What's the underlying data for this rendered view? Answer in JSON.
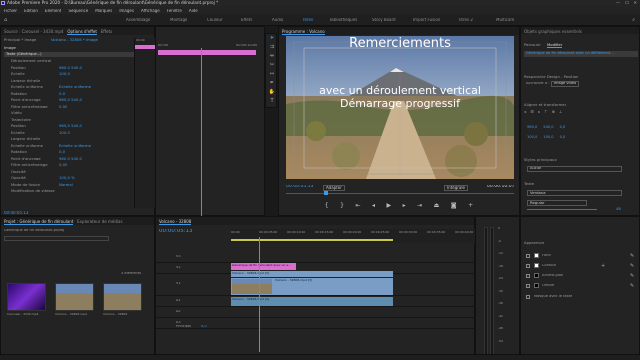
{
  "window": {
    "title": "Adobe Premiere Pro 2020 - D:\\Bureau\\Générique de fin déroulant\\Générique de fin déroulant.prproj *"
  },
  "menu": [
    "Fichier",
    "Edition",
    "Elément",
    "Séquence",
    "Marques",
    "Images",
    "Affichage",
    "Fenêtre",
    "Aide"
  ],
  "workspaces": [
    "Assemblage",
    "Montage",
    "Couleur",
    "Effets",
    "Audio",
    "Titres",
    "Bibliothèques",
    "Story Board",
    "Import Fusion",
    "Titres 2",
    "Multicam"
  ],
  "active_workspace": "Titres",
  "effects_panel": {
    "tabs": [
      "Source : Carousel - 3430.mp4",
      "Options d'effet",
      "Effets"
    ],
    "header": "Principal * Image",
    "clip": "Volcano - 32808 * Image",
    "time_start": "00:00",
    "time_end": "00:00:10:00",
    "group_title": "Image",
    "text_layer": "Texte (Générique...)",
    "rows": [
      {
        "label": "Déroulement vertical",
        "value": ""
      },
      {
        "label": "Position",
        "value": "960,0   540,0"
      },
      {
        "label": "Echelle",
        "value": "100,0"
      },
      {
        "label": "Largeur échelle",
        "value": ""
      },
      {
        "label": "Echelle uniforme",
        "value": "Echelle uniforme"
      },
      {
        "label": "Rotation",
        "value": "0,0"
      },
      {
        "label": "Point d'ancrage",
        "value": "960,0   540,0"
      },
      {
        "label": "Filtre anticrénelage",
        "value": "0,00"
      },
      {
        "label": "Vidéo",
        "value": ""
      },
      {
        "label": "Trajectoire",
        "value": ""
      },
      {
        "label": "Position",
        "value": "960,0   540,0"
      },
      {
        "label": "Echelle",
        "value": "100,0"
      },
      {
        "label": "Largeur échelle",
        "value": ""
      },
      {
        "label": "Echelle uniforme",
        "value": "Echelle uniforme"
      },
      {
        "label": "Rotation",
        "value": "0,0"
      },
      {
        "label": "Point d'ancrage",
        "value": "960,0   540,0"
      },
      {
        "label": "Filtre anticrénelage",
        "value": "0,00"
      },
      {
        "label": "Opacité",
        "value": ""
      },
      {
        "label": "Opacité",
        "value": "100,0 %"
      },
      {
        "label": "Mode de fusion",
        "value": "Normal"
      },
      {
        "label": "Modification de vitesse",
        "value": ""
      }
    ],
    "timecode": "00:00:05:13"
  },
  "program_monitor": {
    "tab": "Programme : Volcano",
    "title_lines": [
      "Remerciements",
      "avec un déroulement vertical",
      "Démarrage progressif"
    ],
    "timecode": "00:00:05:13",
    "fit": "Adapter",
    "quality": "Intégrale",
    "duration": "00:00:10:07"
  },
  "essential_graphics": {
    "tabs": [
      "Parcourir",
      "Modifier"
    ],
    "layer": "Générique de fin déroulant avec un défilement...",
    "responsive_label": "Responsive Design - Position",
    "pin_label": "Accrocher à :",
    "pin_value": "Image vidéo",
    "align_label": "Aligner et transformer",
    "pos_values": [
      "960,0",
      "540,0",
      "0,0",
      "100,0",
      "100,0",
      "0,0"
    ],
    "master_styles_label": "Styles principaux",
    "master_styles_value": "Aucun",
    "text_label": "Texte",
    "font": "Verdana",
    "font_style": "Regular",
    "font_size": "48",
    "appearance_label": "Apparence",
    "fill_label": "Fond",
    "stroke_label": "Contour",
    "bg_label": "Arrière-plan",
    "shadow_label": "Ombre",
    "mask_label": "Masque avec le texte",
    "colors": {
      "fill": "#ffffff",
      "stroke": "#ffffff",
      "bg": "#000000",
      "shadow": "#000000"
    }
  },
  "project_panel": {
    "tabs": [
      "Projet : Générique de fin déroulant",
      "Explorateur de médias"
    ],
    "path": "Générique de fin déroulant.prproj",
    "count": "3 éléments",
    "items": [
      {
        "name": "Carousel - 3430.mp4",
        "duration": "10:07"
      },
      {
        "name": "Volcano - 32808.mp4",
        "duration": "10:07"
      },
      {
        "name": "Volcano - 32808",
        "duration": "10:07"
      }
    ]
  },
  "timeline": {
    "tab": "Volcano - 32808",
    "timecode": "00:00:05:13",
    "ruler": [
      "00:00",
      "00:00:05:00",
      "00:00:10:00",
      "00:00:15:00",
      "00:00:20:00",
      "00:00:25:00",
      "00:00:30:00",
      "00:00:35:00",
      "00:00:40:00"
    ],
    "tracks": [
      "V3",
      "V2",
      "V1",
      "A1",
      "A2",
      "A3"
    ],
    "clips": {
      "graphic": "Générique de fin déroulant avec un e...",
      "video_top": "Volcano - 32808.mp4 [V]",
      "video_main": "Volcano - 32808.mp4 [V]",
      "audio": "Volcano - 32808.mp4 [A]"
    },
    "master_label": "Principal",
    "master_value": "0,0"
  },
  "audio_meter": {
    "labels": [
      "0",
      "-6",
      "-12",
      "-18",
      "-24",
      "-30",
      "-36",
      "-42",
      "-48",
      "-54"
    ]
  }
}
